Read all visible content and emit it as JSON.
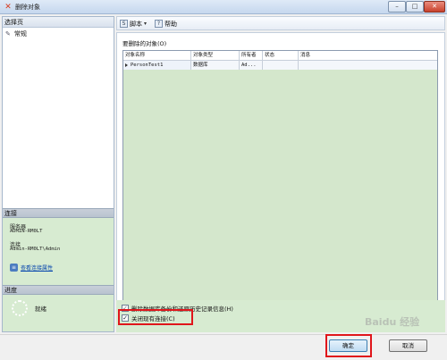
{
  "window": {
    "title": "删除对象",
    "app_icon": "x-mark-icon",
    "minimize_glyph": "–",
    "maximize_glyph": "□",
    "close_glyph": "✕"
  },
  "left_pane": {
    "header": "选择页",
    "pages": [
      {
        "label": "常规",
        "icon": "page-icon"
      }
    ],
    "connection": {
      "header": "连接",
      "server_label": "服务器",
      "server_value": "ADMIN-RM0LT",
      "connection_label": "连接",
      "connection_value": "Admin-RM0LT\\Admin",
      "view_properties_link": "查看连接属性"
    },
    "progress": {
      "header": "进度",
      "status": "就绪"
    }
  },
  "toolbar": {
    "script_label": "脚本",
    "help_label": "帮助"
  },
  "main": {
    "objects_label": "要删除的对象(O)",
    "columns": [
      "对象名称",
      "对象类型",
      "所有者",
      "状态",
      "消息"
    ],
    "rows": [
      {
        "name": "PersonTest1",
        "type": "数据库",
        "owner": "Ad...",
        "status": "",
        "message": ""
      }
    ]
  },
  "options": {
    "delete_backup_history": {
      "label": "删除数据库备份和还原历史记录信息(H)",
      "checked": true
    },
    "close_connections": {
      "label": "关闭现有连接(C)",
      "checked": true
    }
  },
  "buttons": {
    "ok": "确定",
    "cancel": "取消"
  },
  "watermark": "Baidu 经验",
  "colors": {
    "accent": "#3c7fb1",
    "highlight_red": "#e0161b",
    "panel_green": "#d7ebd1"
  }
}
